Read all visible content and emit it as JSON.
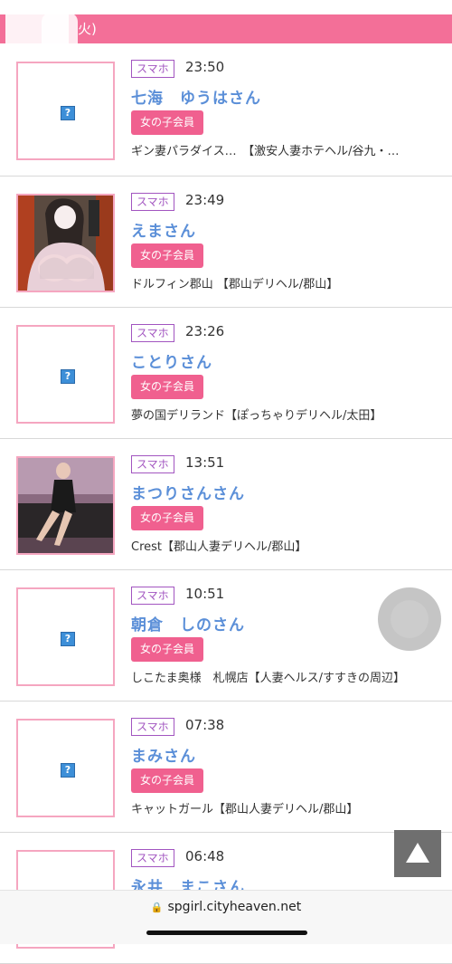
{
  "date_header": {
    "text": "火)"
  },
  "entries": [
    {
      "device": "スマホ",
      "time": "23:50",
      "name": "七海　ゆうはさん",
      "member": "女の子会員",
      "shop": "ギン妻パラダイス…　【激安人妻ホテヘル/谷九・…",
      "has_photo": false
    },
    {
      "device": "スマホ",
      "time": "23:49",
      "name": "えまさん",
      "member": "女の子会員",
      "shop": "ドルフィン郡山 【郡山デリヘル/郡山】",
      "has_photo": true
    },
    {
      "device": "スマホ",
      "time": "23:26",
      "name": "ことりさん",
      "member": "女の子会員",
      "shop": "夢の国デリランド【ぽっちゃりデリヘル/太田】",
      "has_photo": false
    },
    {
      "device": "スマホ",
      "time": "13:51",
      "name": "まつりさんさん",
      "member": "女の子会員",
      "shop": "Crest【郡山人妻デリヘル/郡山】",
      "has_photo": true
    },
    {
      "device": "スマホ",
      "time": "10:51",
      "name": "朝倉　しのさん",
      "member": "女の子会員",
      "shop": "しこたま奥様　札幌店【人妻ヘルス/すすきの周辺】",
      "has_photo": false
    },
    {
      "device": "スマホ",
      "time": "07:38",
      "name": "まみさん",
      "member": "女の子会員",
      "shop": "キャットガール【郡山人妻デリヘル/郡山】",
      "has_photo": false
    },
    {
      "device": "スマホ",
      "time": "06:48",
      "name": "永井　まこさん",
      "member": "",
      "shop": "",
      "has_photo": false
    }
  ],
  "placeholder_icon": "?",
  "browser": {
    "url": "spgirl.cityheaven.net",
    "lock_icon": "lock-icon"
  },
  "colors": {
    "accent": "#f36f98",
    "name": "#5b8fd8",
    "badge": "#a255c0",
    "member": "#f0608f"
  }
}
